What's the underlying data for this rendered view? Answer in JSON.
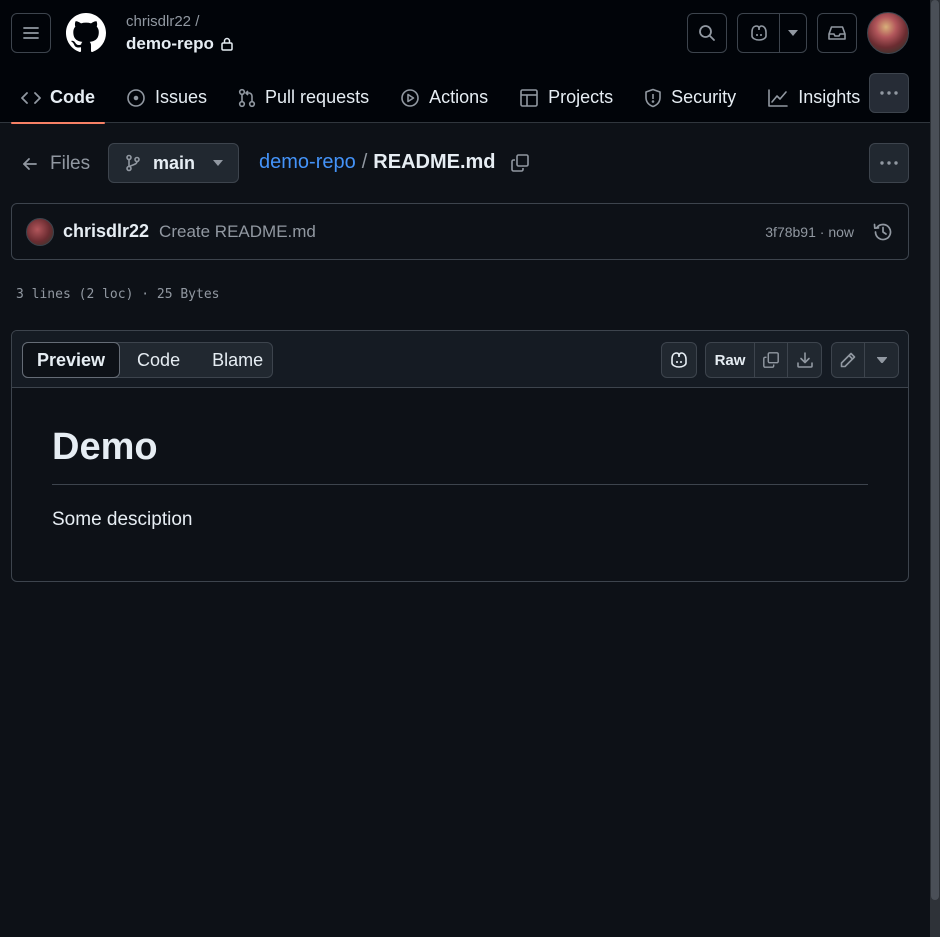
{
  "header": {
    "owner": "chrisdlr22 /",
    "repo": "demo-repo"
  },
  "tabs": [
    {
      "label": "Code",
      "icon": "code-icon",
      "active": true
    },
    {
      "label": "Issues",
      "icon": "issue-icon"
    },
    {
      "label": "Pull requests",
      "icon": "pull-request-icon"
    },
    {
      "label": "Actions",
      "icon": "play-icon"
    },
    {
      "label": "Projects",
      "icon": "table-icon"
    },
    {
      "label": "Security",
      "icon": "shield-icon"
    },
    {
      "label": "Insights",
      "icon": "graph-icon"
    }
  ],
  "breadcrumb": {
    "files_label": "Files",
    "branch": "main",
    "repo_link": "demo-repo",
    "separator": "/",
    "file": "README.md"
  },
  "commit": {
    "author": "chrisdlr22",
    "message": "Create README.md",
    "meta": "3f78b91 · now"
  },
  "file_info": "3 lines (2 loc) · 25 Bytes",
  "viewer": {
    "tabs": [
      "Preview",
      "Code",
      "Blame"
    ],
    "raw_label": "Raw"
  },
  "readme": {
    "heading": "Demo",
    "paragraph": "Some desciption"
  },
  "colors": {
    "accent": "#f78166",
    "link": "#4493f8",
    "bg": "#0d1117",
    "header_bg": "#010409"
  }
}
